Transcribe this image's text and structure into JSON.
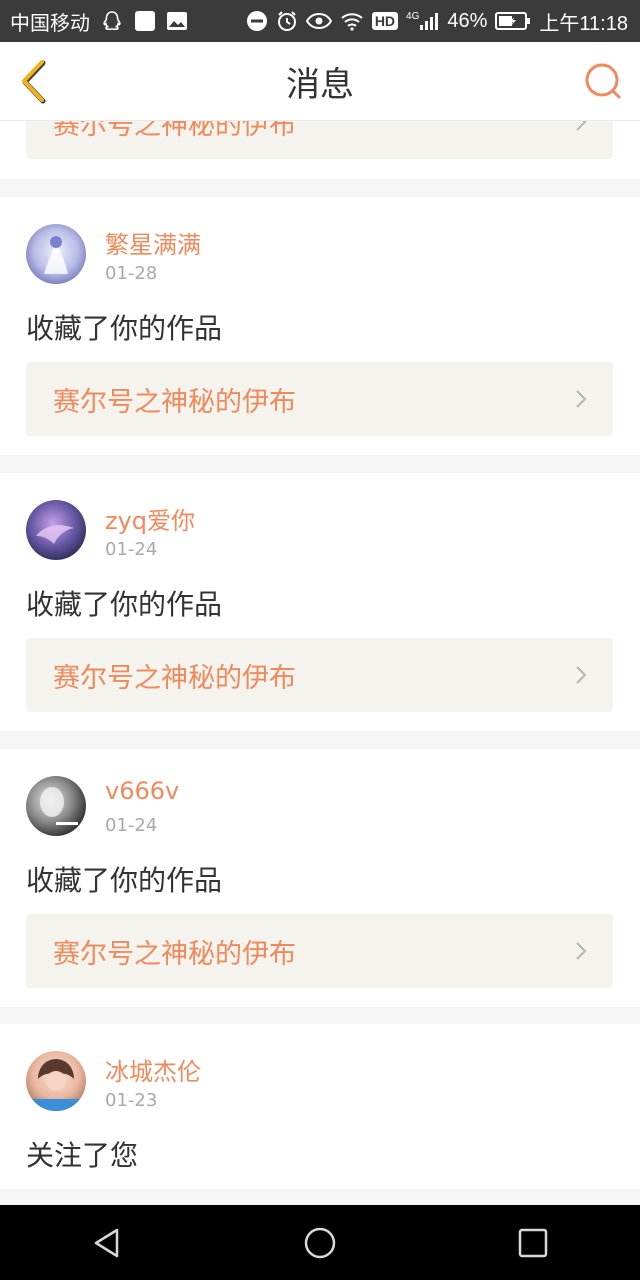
{
  "status_bar": {
    "carrier": "中国移动",
    "network_badge": "HD",
    "network_type": "4G",
    "battery": "46%",
    "time": "上午11:18",
    "icons": [
      "qq-icon",
      "square-app-icon",
      "image-icon",
      "dnd-icon",
      "alarm-icon",
      "eye-icon",
      "wifi-icon",
      "signal-icon",
      "battery-icon"
    ]
  },
  "header": {
    "title": "消息",
    "back_icon": "back-chevron-icon",
    "search_icon": "search-icon"
  },
  "colors": {
    "accent": "#f08a5b",
    "back_icon": "#f2b21a",
    "text": "#333333",
    "muted": "#aaaaaa",
    "card_bg": "#ffffff",
    "work_bg": "#f4f3ee",
    "page_bg": "#f5f5f5"
  },
  "notifications": [
    {
      "work_title": "赛尔号之神秘的伊布"
    },
    {
      "user": "繁星满满",
      "date": "01-28",
      "action": "收藏了你的作品",
      "work_title": "赛尔号之神秘的伊布"
    },
    {
      "user": "zyq爱你",
      "date": "01-24",
      "action": "收藏了你的作品",
      "work_title": "赛尔号之神秘的伊布"
    },
    {
      "user": "v666v",
      "date": "01-24",
      "action": "收藏了你的作品",
      "work_title": "赛尔号之神秘的伊布"
    },
    {
      "user": "冰城杰伦",
      "date": "01-23",
      "action": "关注了您"
    }
  ],
  "nav": {
    "icons": [
      "back-triangle-icon",
      "home-circle-icon",
      "recents-square-icon"
    ]
  }
}
